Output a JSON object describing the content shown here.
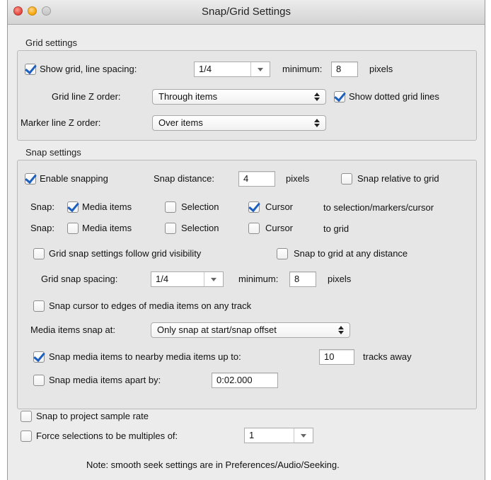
{
  "window": {
    "title": "Snap/Grid Settings"
  },
  "grid": {
    "section_title": "Grid settings",
    "show_grid_label": "Show grid, line spacing:",
    "line_spacing": "1/4",
    "minimum_label": "minimum:",
    "minimum_value": "8",
    "pixels_label": "pixels",
    "grid_z_label": "Grid line Z order:",
    "grid_z_value": "Through items",
    "dotted_label": "Show dotted grid lines",
    "marker_z_label": "Marker line Z order:",
    "marker_z_value": "Over items"
  },
  "snap": {
    "section_title": "Snap settings",
    "enable_label": "Enable snapping",
    "distance_label": "Snap distance:",
    "distance_value": "4",
    "pixels_label": "pixels",
    "relative_label": "Snap relative to grid",
    "row_label": "Snap:",
    "media_items_label": "Media items",
    "selection_label": "Selection",
    "cursor_label": "Cursor",
    "row1_target": "to selection/markers/cursor",
    "row2_target": "to grid",
    "follow_visibility_label": "Grid snap settings follow grid visibility",
    "any_distance_label": "Snap to grid at any distance",
    "spacing_label": "Grid snap spacing:",
    "spacing_value": "1/4",
    "minimum_label": "minimum:",
    "minimum_value": "8",
    "spacing_pixels_label": "pixels",
    "cursor_edges_label": "Snap cursor to edges of media items on any track",
    "media_snap_at_label": "Media items snap at:",
    "media_snap_at_value": "Only snap at start/snap offset",
    "nearby_label": "Snap media items to nearby media items up to:",
    "nearby_value": "10",
    "tracks_away_label": "tracks away",
    "apart_label": "Snap media items apart by:",
    "apart_value": "0:02.000"
  },
  "bottom": {
    "project_rate_label": "Snap to project sample rate",
    "force_label": "Force selections to be multiples of:",
    "force_value": "1",
    "note": "Note: smooth seek settings are in Preferences/Audio/Seeking."
  },
  "colors": {
    "accent": "#1c5fbe",
    "window_bg": "#ececec",
    "panel_bg": "#e6e6e6"
  }
}
